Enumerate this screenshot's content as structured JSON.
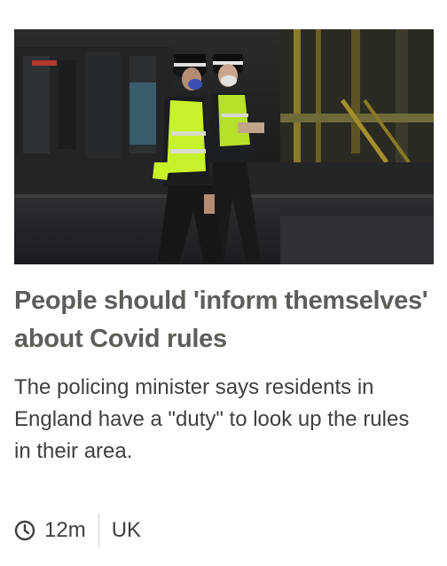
{
  "story": {
    "headline": "People should 'inform themselves' about Covid rules",
    "summary": "The policing minister says residents in England have a \"duty\" to look up the rules in their area.",
    "image_icon": "photo-two-police-officers-walking"
  },
  "meta": {
    "time_icon": "clock-icon",
    "timestamp": "12m",
    "section": "UK"
  },
  "colors": {
    "headline": "#5d5d59",
    "summary": "#3f3f42",
    "divider": "#d0d0d0",
    "hi_vis": "#c8f22a"
  }
}
